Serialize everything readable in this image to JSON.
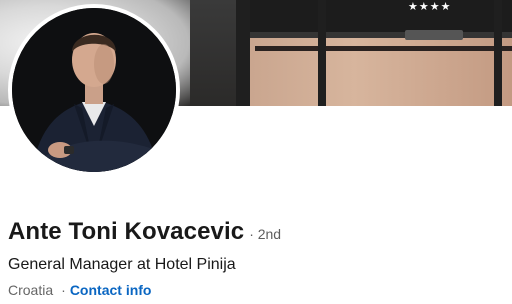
{
  "cover": {
    "image_name": "hotel-entrance-cover",
    "stars": "★★★★"
  },
  "profile": {
    "avatar_name": "profile-photo",
    "name": "Ante Toni Kovacevic",
    "degree": "· 2nd",
    "headline": "General Manager at Hotel Pinija",
    "location": "Croatia",
    "separator": "·",
    "contact_label": "Contact info"
  },
  "colors": {
    "name_text": "#191919",
    "muted_text": "#666666",
    "link_blue": "#0a66c2",
    "avatar_border": "#ffffff"
  }
}
